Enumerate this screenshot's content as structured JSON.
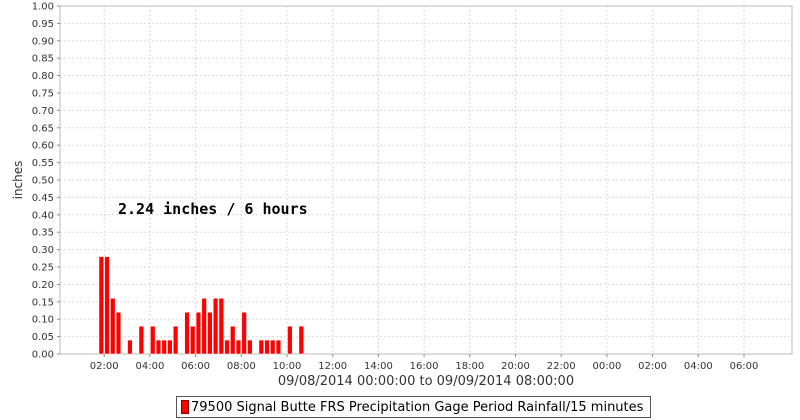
{
  "chart_data": {
    "type": "bar",
    "annotation": "2.24 inches / 6 hours",
    "xlabel": "09/08/2014 00:00:00 to 09/09/2014 08:00:00",
    "ylabel": "inches",
    "ylim": [
      0,
      1.0
    ],
    "yticks": [
      "0.00",
      "0.05",
      "0.10",
      "0.15",
      "0.20",
      "0.25",
      "0.30",
      "0.35",
      "0.40",
      "0.45",
      "0.50",
      "0.55",
      "0.60",
      "0.65",
      "0.70",
      "0.75",
      "0.80",
      "0.85",
      "0.90",
      "0.95",
      "1.00"
    ],
    "xticks": [
      "02:00",
      "04:00",
      "06:00",
      "08:00",
      "10:00",
      "12:00",
      "14:00",
      "16:00",
      "18:00",
      "20:00",
      "22:00",
      "00:00",
      "02:00",
      "04:00",
      "06:00"
    ],
    "grid": true,
    "legend_position": "bottom",
    "bar_interval": "15 minutes",
    "series": [
      {
        "name": "79500 Signal Butte FRS Precipitation Gage Period Rainfall/15 minutes",
        "color": "#ff0000",
        "x": [
          "01:45",
          "02:00",
          "02:15",
          "02:30",
          "03:00",
          "03:30",
          "04:00",
          "04:15",
          "04:30",
          "04:45",
          "05:00",
          "05:30",
          "05:45",
          "06:00",
          "06:15",
          "06:30",
          "06:45",
          "07:00",
          "07:15",
          "07:30",
          "07:45",
          "08:00",
          "08:15",
          "08:45",
          "09:00",
          "09:15",
          "09:30",
          "10:00",
          "10:30"
        ],
        "values": [
          0.28,
          0.28,
          0.16,
          0.12,
          0.04,
          0.08,
          0.08,
          0.04,
          0.04,
          0.04,
          0.08,
          0.12,
          0.08,
          0.12,
          0.16,
          0.12,
          0.16,
          0.16,
          0.04,
          0.08,
          0.04,
          0.12,
          0.04,
          0.04,
          0.04,
          0.04,
          0.04,
          0.08,
          0.08
        ]
      }
    ]
  }
}
